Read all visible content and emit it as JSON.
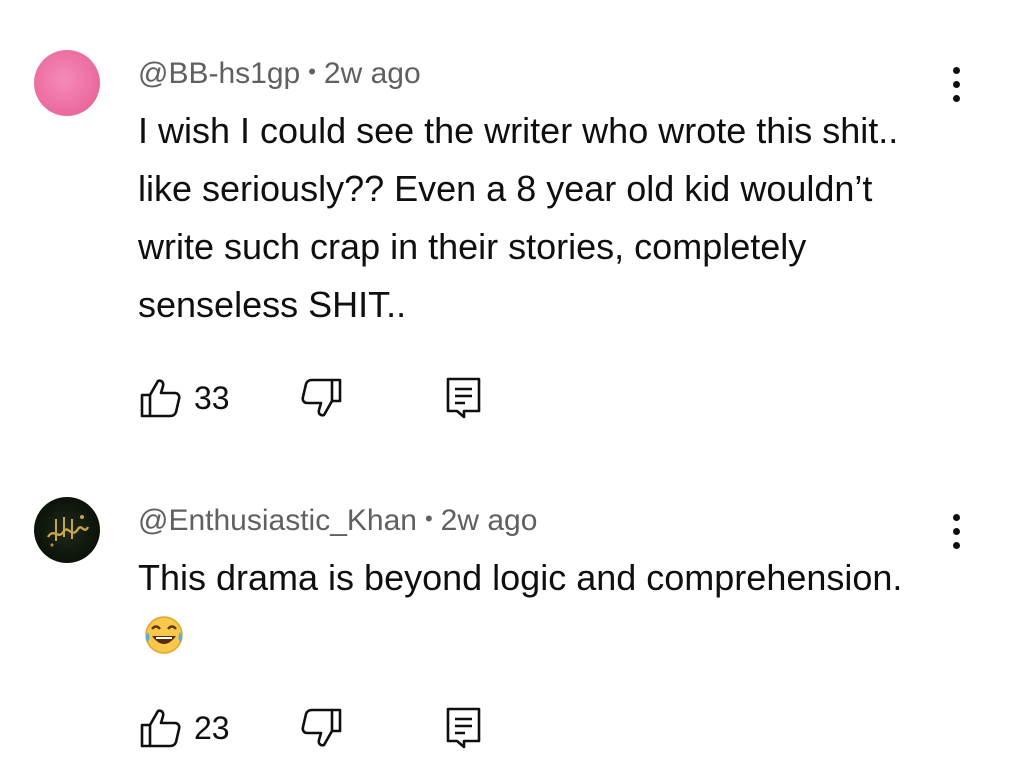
{
  "comments": [
    {
      "author": "@BB-hs1gp",
      "separator": "•",
      "time": "2w ago",
      "text": "I wish I could see the writer who wrote this shit.. like seriously?? Even a 8 year old kid wouldn’t write such crap in their stories, completely senseless SHIT..",
      "likes": "33",
      "avatar_color": "#ec6ea0"
    },
    {
      "author": "@Enthusiastic_Khan",
      "separator": "•",
      "time": "2w ago",
      "text": "This drama is beyond logic and comprehension.",
      "emoji": "face-with-tears-of-joy",
      "likes": "23",
      "avatar_color": "#0c120a"
    }
  ],
  "icons": {
    "like": "thumbs-up-icon",
    "dislike": "thumbs-down-icon",
    "reply": "reply-comment-icon",
    "more": "more-vertical-icon"
  }
}
